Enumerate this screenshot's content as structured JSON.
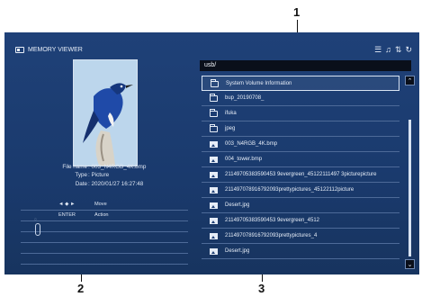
{
  "callouts": {
    "one": "1",
    "two": "2",
    "three": "3"
  },
  "viewer": {
    "title": "MEMORY VIEWER"
  },
  "top_icons": [
    "sort-list-icon",
    "music-icon",
    "sort-az-icon",
    "repeat-icon"
  ],
  "file_info": [
    {
      "key": "File name",
      "value": ": 003_N4RGB_4K.bmp"
    },
    {
      "key": "Type",
      "value": ": Picture"
    },
    {
      "key": "Date",
      "value": ": 2020/01/27 16:27:48"
    }
  ],
  "keys": [
    {
      "key": "◄ ◆ ►",
      "action": "Move"
    },
    {
      "key": "ENTER",
      "action": "Action"
    }
  ],
  "path": "usb/",
  "files": [
    {
      "name": "System Volume Information",
      "type": "folder",
      "selected": true
    },
    {
      "name": "bup_20190708_",
      "type": "folder"
    },
    {
      "name": "ifuka",
      "type": "folder"
    },
    {
      "name": "jpeg",
      "type": "folder"
    },
    {
      "name": "003_N4RGB_4K.bmp",
      "type": "image"
    },
    {
      "name": "004_tower.bmp",
      "type": "image"
    },
    {
      "name": "21149705383590453 9evergreen_45122111497 3picturepicture",
      "type": "image"
    },
    {
      "name": "211497078916792093prettypictures_45122112picture",
      "type": "image"
    },
    {
      "name": "Desert.jpg",
      "type": "image"
    },
    {
      "name": "21149705383590453 9evergreen_4512",
      "type": "image"
    },
    {
      "name": "211497078916792093prettypictures_4",
      "type": "image"
    },
    {
      "name": "Desert.jpg",
      "type": "image"
    }
  ],
  "scroll": {
    "up": "⌃",
    "down": "⌄"
  }
}
